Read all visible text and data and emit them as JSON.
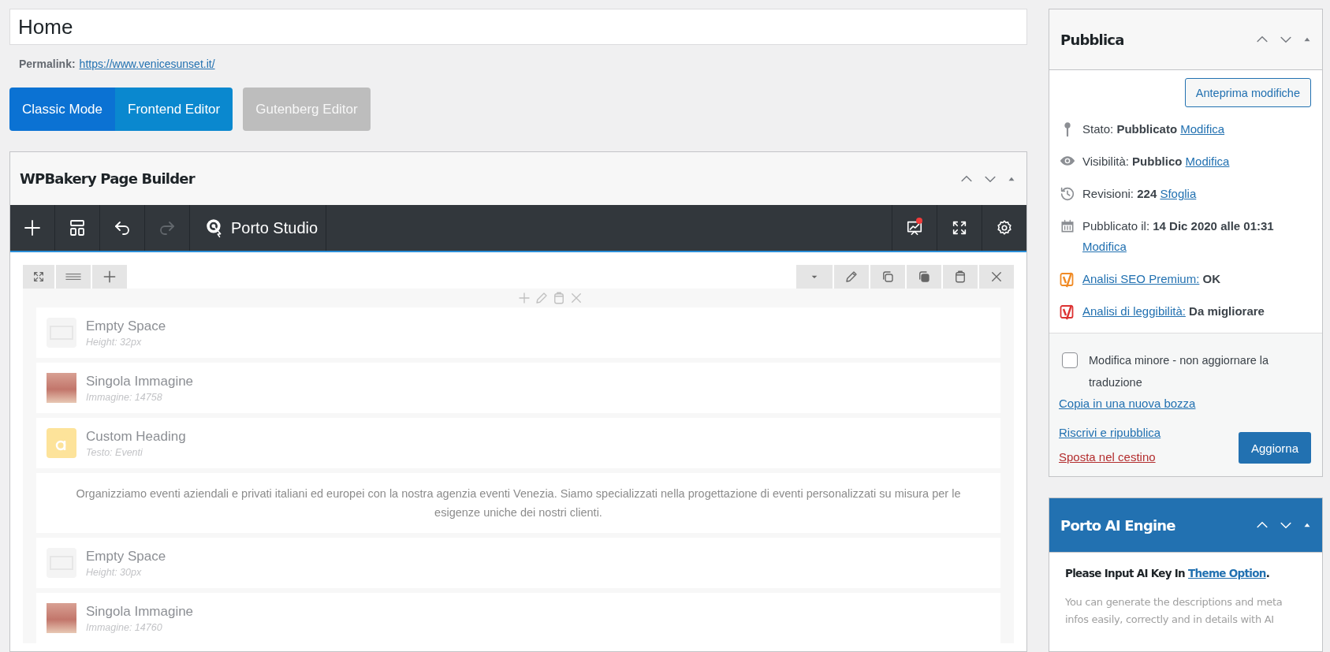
{
  "title_field": {
    "value": "Home"
  },
  "permalink": {
    "label": "Permalink:",
    "url": "https://www.venicesunset.it/"
  },
  "mode_buttons": [
    {
      "label": "Classic Mode",
      "kind": "classic"
    },
    {
      "label": "Frontend Editor",
      "kind": "frontend"
    },
    {
      "label": "Gutenberg Editor",
      "kind": "gutenberg"
    }
  ],
  "builder": {
    "title": "WPBakery Page Builder",
    "toolbar_left": [
      {
        "kind": "add",
        "disabled": false
      },
      {
        "kind": "templates",
        "disabled": false
      },
      {
        "kind": "undo",
        "disabled": false
      },
      {
        "kind": "redo",
        "disabled": true
      },
      {
        "kind": "studio",
        "label": "Porto Studio",
        "disabled": false
      }
    ],
    "toolbar_right": [
      {
        "kind": "chart",
        "notification": true
      },
      {
        "kind": "fullscreen",
        "notification": false
      },
      {
        "kind": "settings",
        "notification": false
      }
    ],
    "elements": [
      {
        "kind": "empty_space",
        "title": "Empty Space",
        "subtitle": "Height: 32px"
      },
      {
        "kind": "image",
        "title": "Singola Immagine",
        "subtitle": "Immagine: 14758"
      },
      {
        "kind": "heading",
        "title": "Custom Heading",
        "subtitle": "Testo: Eventi"
      },
      {
        "kind": "text",
        "text": "Organizziamo eventi aziendali e privati italiani ed europei con la nostra agenzia eventi Venezia. Siamo specializzati nella progettazione di eventi personalizzati su misura per le esigenze uniche dei nostri clienti."
      },
      {
        "kind": "empty_space",
        "title": "Empty Space",
        "subtitle": "Height: 30px"
      },
      {
        "kind": "image",
        "title": "Singola Immagine",
        "subtitle": "Immagine: 14760"
      }
    ]
  },
  "publish": {
    "title": "Pubblica",
    "preview_button": "Anteprima modifiche",
    "rows": [
      {
        "kind": "status",
        "label": "Stato:",
        "value": "Pubblicato",
        "link": "Modifica"
      },
      {
        "kind": "visibility",
        "label": "Visibilità:",
        "value": "Pubblico",
        "link": "Modifica"
      },
      {
        "kind": "revisions",
        "label": "Revisioni:",
        "value": "224",
        "link": "Sfoglia"
      },
      {
        "kind": "date",
        "label": "Pubblicato il:",
        "value": "14 Dic 2020 alle 01:31",
        "link": "Modifica"
      },
      {
        "kind": "seo",
        "color": "#f08a24",
        "link": "Analisi SEO Premium:",
        "value": "OK"
      },
      {
        "kind": "seo",
        "color": "#dc3232",
        "link": "Analisi di leggibilità:",
        "value": "Da migliorare"
      }
    ],
    "minor_edit": {
      "label": "Modifica minore - non aggiornare la traduzione",
      "checked": false
    },
    "copy_link": "Copia in una nuova bozza",
    "rewrite_link": "Riscrivi e ripubblica",
    "trash_link": "Sposta nel cestino",
    "update_button": "Aggiorna"
  },
  "ai_engine": {
    "title": "Porto AI Engine",
    "notice_prefix": "Please Input AI Key In ",
    "notice_link": "Theme Option",
    "notice_suffix": ".",
    "description": "You can generate the descriptions and meta infos easily, correctly and in details with AI"
  }
}
